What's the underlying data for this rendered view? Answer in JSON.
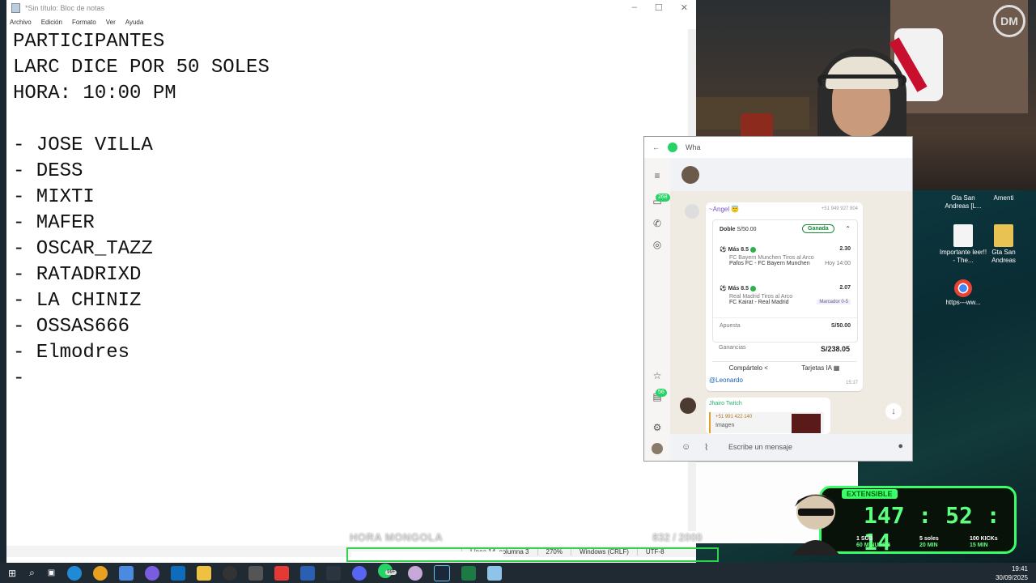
{
  "notepad": {
    "title": "*Sin título: Bloc de notas",
    "menu": [
      "Archivo",
      "Edición",
      "Formato",
      "Ver",
      "Ayuda"
    ],
    "lines": [
      "PARTICIPANTES",
      "LARC DICE POR 50 SOLES",
      "HORA: 10:00 PM",
      "",
      "- JOSE VILLA",
      "- DESS",
      "- MIXTI",
      "- MAFER",
      "- OSCAR_TAZZ",
      "- RATADRIXD",
      "- LA CHINIZ",
      "- OSSAS666",
      "- Elmodres",
      "-"
    ],
    "status": {
      "position": "Línea 14, columna 3",
      "zoom": "270%",
      "line_ending": "Windows (CRLF)",
      "encoding": "UTF-8"
    }
  },
  "overlay": {
    "label": "HORA MONGOLA",
    "counter": "832 / 2000"
  },
  "whatsapp": {
    "title": "Wha",
    "chats_badge": "268",
    "status_badge": "56",
    "sender": "~Angel 😇",
    "sender_phone": "+51 949 927 804",
    "bet": {
      "type": "Doble",
      "amount": "S/50.00",
      "result": "Ganada",
      "pick1": {
        "market": "Más 8.5",
        "odds": "2.30",
        "detail": "FC Bayern Munchen Tiros al Arco",
        "match": "Pafos FC - FC Bayern Munchen",
        "when": "Hoy 14:00"
      },
      "pick2": {
        "market": "Más 8.5",
        "odds": "2.07",
        "detail": "Real Madrid Tiros al Arco",
        "match": "FC Kairat - Real Madrid",
        "score": "Marcador 0-5"
      },
      "stake_label": "Apuesta",
      "stake": "S/50.00",
      "winnings_label": "Ganancias",
      "winnings": "S/238.05",
      "share": "Compártelo",
      "cards": "Tarjetas IA"
    },
    "mention": "@Leonardo",
    "msg_time": "15:17",
    "next_sender": "Jhairo Twitch",
    "quoted_phone": "+51 991 422 140",
    "quoted_type": "Imagen",
    "input_placeholder": "Escribe un mensaje"
  },
  "desktop": {
    "icons": [
      {
        "label": "Gta San Andreas [L..."
      },
      {
        "label": "Amenti"
      },
      {
        "label": "Importante leer!! - The..."
      },
      {
        "label": "Gta San Andreas"
      },
      {
        "label": "https---ww..."
      }
    ]
  },
  "countdown": {
    "tag": "EXTENSIBLE",
    "time": "147 : 52 : 14",
    "r1a": "1 SUB",
    "r1b": "60 MINUTOS",
    "r2a": "5 soles",
    "r2b": "20 MIN",
    "r3a": "100 KICKs",
    "r3b": "15 MIN"
  },
  "taskbar": {
    "badge": "99+",
    "time": "19:41",
    "date": "30/09/2025"
  }
}
